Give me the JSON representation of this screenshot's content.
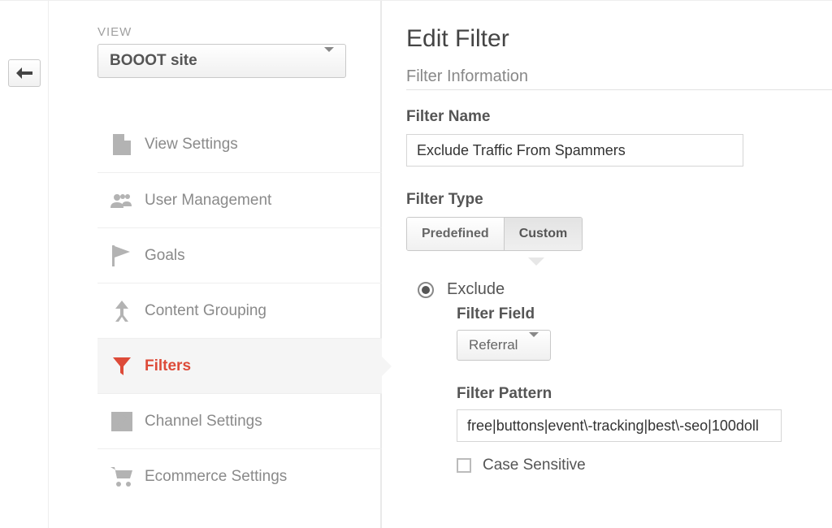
{
  "sidebar": {
    "section_label": "VIEW",
    "dropdown_value": "BOOOT site",
    "items": [
      {
        "label": "View Settings"
      },
      {
        "label": "User Management"
      },
      {
        "label": "Goals"
      },
      {
        "label": "Content Grouping"
      },
      {
        "label": "Filters"
      },
      {
        "label": "Channel Settings"
      },
      {
        "label": "Ecommerce Settings"
      }
    ]
  },
  "main": {
    "title": "Edit Filter",
    "section": "Filter Information",
    "filter_name_label": "Filter Name",
    "filter_name_value": "Exclude Traffic From Spammers",
    "filter_type_label": "Filter Type",
    "tabs": {
      "predefined": "Predefined",
      "custom": "Custom"
    },
    "exclude_label": "Exclude",
    "filter_field_label": "Filter Field",
    "filter_field_value": "Referral",
    "filter_pattern_label": "Filter Pattern",
    "filter_pattern_value": "free|buttons|event\\-tracking|best\\-seo|100doll",
    "case_sensitive_label": "Case Sensitive"
  }
}
